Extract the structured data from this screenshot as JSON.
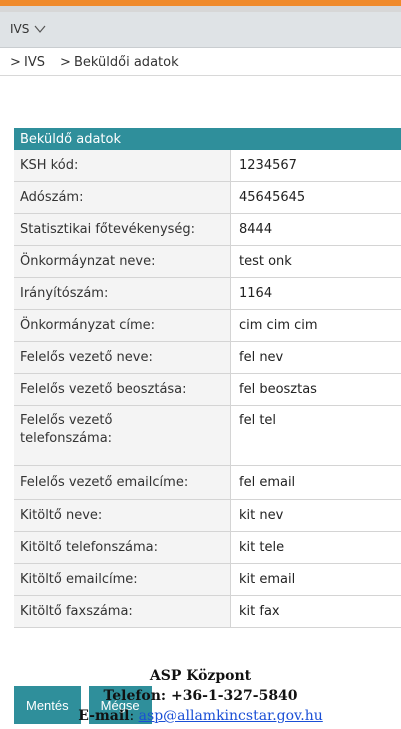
{
  "menu": {
    "label": "IVS",
    "caret_icon": "chevron-down-icon"
  },
  "breadcrumb": {
    "separator": ">",
    "items": [
      "IVS",
      "Beküldői adatok"
    ]
  },
  "section": {
    "title": "Beküldő adatok"
  },
  "fields": [
    {
      "label": "KSH kód:",
      "value": "1234567"
    },
    {
      "label": "Adószám:",
      "value": "45645645"
    },
    {
      "label": "Statisztikai főtevékenység:",
      "value": "8444"
    },
    {
      "label": "Önkormáynzat neve:",
      "value": "test onk"
    },
    {
      "label": "Irányítószám:",
      "value": "1164"
    },
    {
      "label": "Önkormányzat címe:",
      "value": "cim cim cim"
    },
    {
      "label": "Felelős vezető neve:",
      "value": "fel nev"
    },
    {
      "label": "Felelős vezető beosztása:",
      "value": "fel beosztas"
    },
    {
      "label": "Felelős vezető telefonszáma:",
      "value": "fel tel"
    },
    {
      "label": "Felelős vezető emailcíme:",
      "value": "fel email"
    },
    {
      "label": "Kitöltő neve:",
      "value": "kit nev"
    },
    {
      "label": "Kitöltő telefonszáma:",
      "value": "kit tele"
    },
    {
      "label": "Kitöltő emailcíme:",
      "value": "kit email"
    },
    {
      "label": "Kitöltő faxszáma:",
      "value": "kit fax"
    }
  ],
  "buttons": {
    "save": "Mentés",
    "cancel": "Mégse"
  },
  "overlay": {
    "line1": "ASP Központ",
    "line2": "Telefon: +36-1-327-5840",
    "email_label": "E-mail",
    "email_sep": ": ",
    "email": "asp@allamkincstar.gov.hu"
  },
  "colors": {
    "accent": "#f08a2b",
    "teal": "#2f8f9b",
    "link": "#1a4fd6"
  }
}
